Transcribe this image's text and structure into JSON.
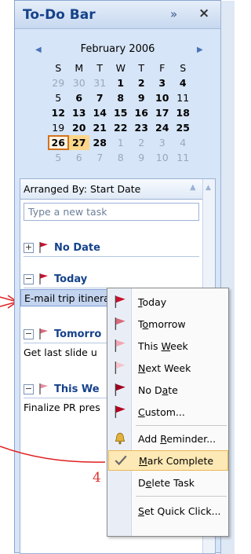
{
  "todo_bar": {
    "title": "To-Do Bar",
    "expand_glyph": "»",
    "close_glyph": "×"
  },
  "calendar": {
    "month": "February 2006",
    "days_of_week": [
      "S",
      "M",
      "T",
      "W",
      "T",
      "F",
      "S"
    ],
    "weeks": [
      [
        {
          "d": "29",
          "g": true
        },
        {
          "d": "30",
          "g": true
        },
        {
          "d": "31",
          "g": true
        },
        {
          "d": "1",
          "b": true
        },
        {
          "d": "2",
          "b": true
        },
        {
          "d": "3",
          "b": true
        },
        {
          "d": "4",
          "b": true
        }
      ],
      [
        {
          "d": "5"
        },
        {
          "d": "6",
          "b": true
        },
        {
          "d": "7",
          "b": true
        },
        {
          "d": "8",
          "b": true
        },
        {
          "d": "9",
          "b": true
        },
        {
          "d": "10",
          "b": true
        },
        {
          "d": "11"
        }
      ],
      [
        {
          "d": "12",
          "b": true
        },
        {
          "d": "13",
          "b": true
        },
        {
          "d": "14",
          "b": true
        },
        {
          "d": "15",
          "b": true
        },
        {
          "d": "16",
          "b": true
        },
        {
          "d": "17",
          "b": true
        },
        {
          "d": "18",
          "b": true
        }
      ],
      [
        {
          "d": "19"
        },
        {
          "d": "20",
          "b": true
        },
        {
          "d": "21",
          "b": true
        },
        {
          "d": "22",
          "b": true
        },
        {
          "d": "23",
          "b": true
        },
        {
          "d": "24",
          "b": true
        },
        {
          "d": "25",
          "b": true
        }
      ],
      [
        {
          "d": "26",
          "b": true,
          "today": true
        },
        {
          "d": "27",
          "b": true,
          "sel": true
        },
        {
          "d": "28",
          "b": true
        },
        {
          "d": "1",
          "g": true
        },
        {
          "d": "2",
          "g": true
        },
        {
          "d": "3",
          "g": true
        },
        {
          "d": "4",
          "g": true
        }
      ],
      [
        {
          "d": "5",
          "g": true
        },
        {
          "d": "6",
          "g": true
        },
        {
          "d": "7",
          "g": true
        },
        {
          "d": "8",
          "g": true
        },
        {
          "d": "9",
          "g": true
        },
        {
          "d": "10",
          "g": true
        },
        {
          "d": "11",
          "g": true
        }
      ]
    ]
  },
  "tasks": {
    "arranged_by": "Arranged By: Start Date",
    "new_task_placeholder": "Type a new task",
    "groups": {
      "no_date": "No Date",
      "today": "Today",
      "tomorrow": "Tomorro",
      "this_week": "This We"
    },
    "items": {
      "today_task": "E-mail trip itinerary to...",
      "tomorrow_task": "Get last slide u",
      "this_week_task": "Finalize PR pres"
    }
  },
  "context_menu": {
    "items": [
      {
        "pre": "",
        "u": "T",
        "post": "oday"
      },
      {
        "pre": "T",
        "u": "o",
        "post": "morrow"
      },
      {
        "pre": "This ",
        "u": "W",
        "post": "eek"
      },
      {
        "pre": "",
        "u": "N",
        "post": "ext Week"
      },
      {
        "pre": "No D",
        "u": "a",
        "post": "te"
      },
      {
        "pre": "",
        "u": "C",
        "post": "ustom..."
      },
      {
        "pre": "Add ",
        "u": "R",
        "post": "eminder..."
      },
      {
        "pre": "",
        "u": "M",
        "post": "ark Complete"
      },
      {
        "pre": "D",
        "u": "e",
        "post": "lete Task"
      },
      {
        "pre": "",
        "u": "S",
        "post": "et Quick Click..."
      }
    ]
  },
  "annotation": {
    "step_number": "4",
    "arrow_color": "#d32020"
  },
  "colors": {
    "flag_red": "#c8102e",
    "flag_pink": "#f2a5b4",
    "highlight": "#fde9b5",
    "title_blue": "#15428b"
  }
}
